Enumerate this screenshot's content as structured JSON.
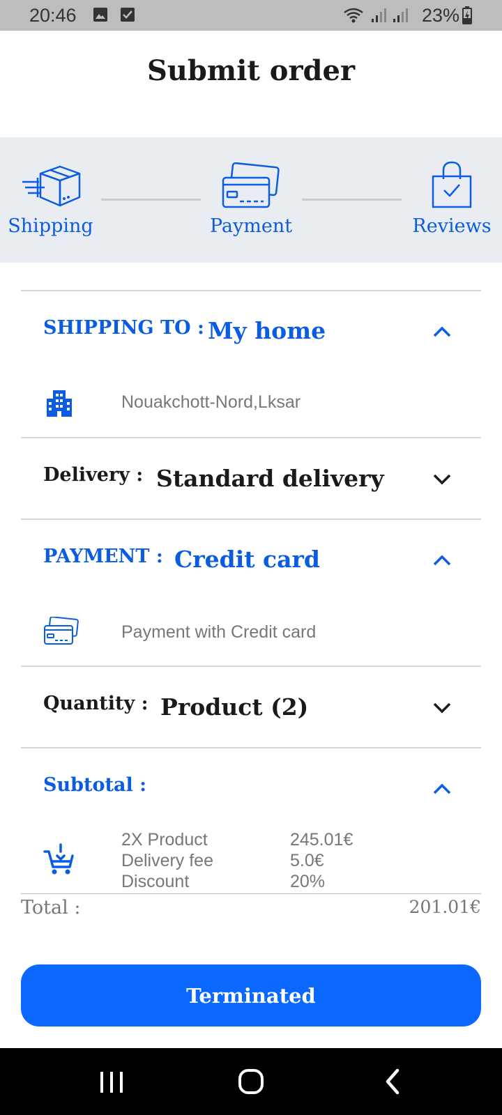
{
  "status_bar": {
    "time": "20:46",
    "battery": "23%",
    "icons": [
      "gallery-icon",
      "check-box-icon",
      "wifi-icon",
      "signal-icon",
      "signal-icon",
      "battery-charging-icon"
    ]
  },
  "header": {
    "title": "Submit order"
  },
  "stepper": {
    "steps": [
      {
        "label": "Shipping",
        "icon": "box-shipping-icon"
      },
      {
        "label": "Payment",
        "icon": "credit-card-icon"
      },
      {
        "label": "Reviews",
        "icon": "shopping-bag-check-icon"
      }
    ]
  },
  "shipping": {
    "label": "SHIPPING TO :",
    "value": "My home",
    "address": "Nouakchott-Nord,Lksar",
    "icon": "building-icon"
  },
  "delivery": {
    "label": "Delivery :",
    "value": "Standard delivery"
  },
  "payment": {
    "label": "PAYMENT :",
    "value": "Credit card",
    "detail": "Payment with Credit card",
    "icon": "credit-card-icon"
  },
  "quantity": {
    "label": "Quantity :",
    "value": "Product (2)"
  },
  "subtotal": {
    "label": "Subtotal :",
    "icon": "add-cart-icon",
    "rows": [
      {
        "name": "2X Product",
        "value": "245.01€"
      },
      {
        "name": "Delivery fee",
        "value": "5.0€"
      },
      {
        "name": "Discount",
        "value": "20%"
      }
    ]
  },
  "total": {
    "label": "Total :",
    "value": "201.01€"
  },
  "submit_button": {
    "label": "Terminated"
  },
  "colors": {
    "accent": "#0a5de0",
    "button": "#0a68ff",
    "stepper_bg": "#e9edf1",
    "status_bar": "#bdbdbd"
  }
}
